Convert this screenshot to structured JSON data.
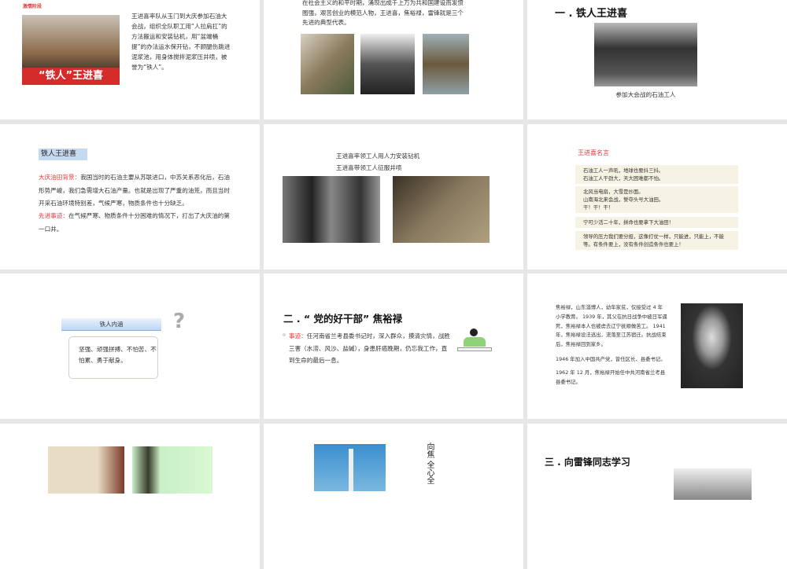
{
  "slides": [
    {
      "label": "激情阶段",
      "poster_text": "“铁人”王进喜",
      "body": "王进喜率队从玉门到大庆参加石油大会战，组织全队职工用“人拉肩扛”的方法搬运和安装钻机，用“盆端桶提”的办法运水保开钻，不顾腿伤跳进泥浆池，用身体搅拌泥浆压井喷，被誉为“铁人”。"
    },
    {
      "body": "在社会主义的和平时期，涌现出成千上万为共和国建设而发愤图强，艰苦创业的模范人物，王进喜，焦裕禄，雷锋就是三个先进的典型代表。"
    },
    {
      "title": "一 . 铁人王进喜",
      "caption": "参加大会战的石油工人"
    },
    {
      "title": "铁人王进喜",
      "bg_label": "大庆油田背景：",
      "bg_text": "我国当时的石油主要从苏联进口，中苏关系恶化后，石油形势严峻，我们急需增大石油产量。也就是出现了严重的油荒，而且当时开采石油环境特别差，气候严寒，物质条件也十分缺乏。",
      "deed_label": "先进事迹：",
      "deed_text": "在气候严寒、物质条件十分困难的情况下，打出了大庆油的第一口井。"
    },
    {
      "caption1": "王进喜率领工人用人力安装钻机",
      "caption2": "王进喜带领工人征服井喷"
    },
    {
      "title": "王进喜名言",
      "quotes": [
        "石油工人一声吼，地球也要抖三抖。\n石油工人干劲大，天大困难都不怕。",
        "北风当电扇，大雪是炒面。\n山南海北来会战，誓夺头号大油田。\n干！干！干！",
        "宁可少活二十年，拼命也要拿下大油田！",
        "领导的压力我们要分担，这像打仗一样，只能进，只能上，不能等。有条件要上，没有条件创造条件也要上！"
      ]
    },
    {
      "header": "铁人内涵",
      "body": "坚强、顽强拼搏、不怕苦、不怕累、勇于献身。"
    },
    {
      "title": "二 . “ 党的好干部” 焦裕禄",
      "deed_label": "事迹：",
      "deed_text": "任河南省兰考县委书记时，深入群众，摸清灾情，战胜三害（水涝、风沙、盐碱），身患肝癌晚期，仍忘我工作，直到生命的最后一息。"
    },
    {
      "p1": "焦裕禄，山东淄博人，幼年家贫，仅接受过 4 年小学教育。 1939 年，其父在抗日战争中被日军逼死，焦裕禄本人也被虏去辽宁抚顺做苦工。 1941 年，焦裕禄设法逃出，流落至江苏宿迁。抗战结束后，焦裕禄回到家乡。",
      "p2": "1946 年加入中国共产党，曾任区长、县委书记。",
      "p3": "1962 年 12 月，焦裕禄开始任中共河南省兰考县县委书记。"
    },
    {},
    {
      "calligraphy": "向焦 全心全"
    },
    {
      "title": "三 . 向雷锋同志学习"
    }
  ]
}
